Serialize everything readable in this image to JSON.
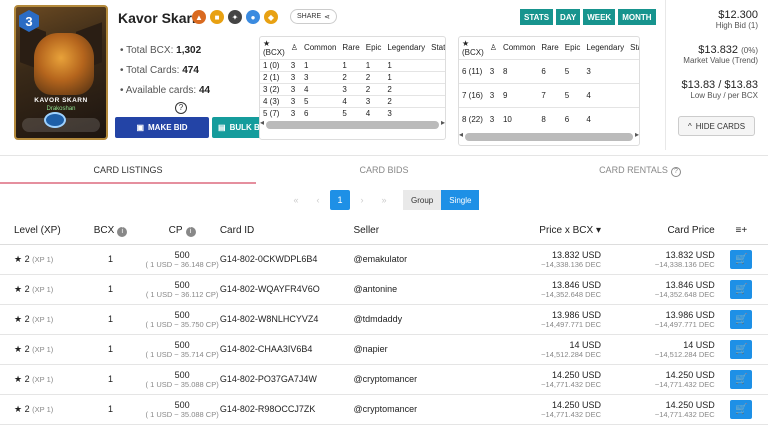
{
  "card": {
    "name": "Kavor Skarn",
    "mana": "3",
    "plate_name": "KAVOR SKARN",
    "plate_sub": "Drakoshan",
    "level_badge": "1"
  },
  "share_label": "SHARE",
  "stats": {
    "total_bcx_label": "Total BCX: ",
    "total_bcx": "1,302",
    "total_cards_label": "Total Cards: ",
    "total_cards": "474",
    "available_label": "Available cards: ",
    "available": "44"
  },
  "buttons": {
    "make_bid": "MAKE BID",
    "bulk_buy": "BULK BUY",
    "hide_cards": "HIDE CARDS"
  },
  "mini_table_headers": [
    "(BCX)",
    "Common",
    "Rare",
    "Epic",
    "Legendary",
    "Stats"
  ],
  "mini_table_1": [
    [
      "1 (0)",
      "3",
      "1",
      "1",
      "1",
      "1"
    ],
    [
      "2 (1)",
      "3",
      "3",
      "2",
      "2",
      "1"
    ],
    [
      "3 (2)",
      "3",
      "4",
      "3",
      "2",
      "2"
    ],
    [
      "4 (3)",
      "3",
      "5",
      "4",
      "3",
      "2"
    ],
    [
      "5 (7)",
      "3",
      "6",
      "5",
      "4",
      "3"
    ]
  ],
  "mini_table_2": [
    [
      "6 (11)",
      "3",
      "8",
      "6",
      "5",
      "3"
    ],
    [
      "7 (16)",
      "3",
      "9",
      "7",
      "5",
      "4"
    ],
    [
      "8 (22)",
      "3",
      "10",
      "8",
      "6",
      "4"
    ]
  ],
  "top_tabs": [
    "STATS",
    "DAY",
    "WEEK",
    "MONTH"
  ],
  "price_panel": {
    "high_bid": "$12.300",
    "high_bid_label": "High Bid (1)",
    "market_value": "$13.832",
    "market_change": "(0%)",
    "market_label": "Market Value (Trend)",
    "low_buy": "$13.83 / $13.83",
    "low_buy_label": "Low Buy / per BCX"
  },
  "section_tabs": [
    "CARD LISTINGS",
    "CARD BIDS",
    "CARD RENTALS"
  ],
  "pager": {
    "first": "«",
    "prev": "‹",
    "page": "1",
    "next": "›",
    "last": "»"
  },
  "toggle": {
    "group": "Group",
    "single": "Single"
  },
  "columns": [
    "Level (XP)",
    "BCX",
    "CP",
    "Card ID",
    "Seller",
    "Price x BCX",
    "Card Price"
  ],
  "rows": [
    {
      "level": "2",
      "xp": "(XP 1)",
      "bcx": "1",
      "cp": "500",
      "cp_sub": "( 1 USD ~ 36.148 CP)",
      "card_id": "G14-802-0CKWDPL6B4",
      "seller": "@emakulator",
      "price": "13.832 USD",
      "price_dec": "~14,338.136 DEC",
      "card_price": "13.832 USD",
      "card_price_dec": "~14,338.136 DEC"
    },
    {
      "level": "2",
      "xp": "(XP 1)",
      "bcx": "1",
      "cp": "500",
      "cp_sub": "( 1 USD ~ 36.112 CP)",
      "card_id": "G14-802-WQAYFR4V6O",
      "seller": "@antonine",
      "price": "13.846 USD",
      "price_dec": "~14,352.648 DEC",
      "card_price": "13.846 USD",
      "card_price_dec": "~14,352.648 DEC"
    },
    {
      "level": "2",
      "xp": "(XP 1)",
      "bcx": "1",
      "cp": "500",
      "cp_sub": "( 1 USD ~ 35.750 CP)",
      "card_id": "G14-802-W8NLHCYVZ4",
      "seller": "@tdmdaddy",
      "price": "13.986 USD",
      "price_dec": "~14,497.771 DEC",
      "card_price": "13.986 USD",
      "card_price_dec": "~14,497.771 DEC"
    },
    {
      "level": "2",
      "xp": "(XP 1)",
      "bcx": "1",
      "cp": "500",
      "cp_sub": "( 1 USD ~ 35.714 CP)",
      "card_id": "G14-802-CHAA3IV6B4",
      "seller": "@napier",
      "price": "14 USD",
      "price_dec": "~14,512.284 DEC",
      "card_price": "14 USD",
      "card_price_dec": "~14,512.284 DEC"
    },
    {
      "level": "2",
      "xp": "(XP 1)",
      "bcx": "1",
      "cp": "500",
      "cp_sub": "( 1 USD ~ 35.088 CP)",
      "card_id": "G14-802-PO37GA7J4W",
      "seller": "@cryptomancer",
      "price": "14.250 USD",
      "price_dec": "~14,771.432 DEC",
      "card_price": "14.250 USD",
      "card_price_dec": "~14,771.432 DEC"
    },
    {
      "level": "2",
      "xp": "(XP 1)",
      "bcx": "1",
      "cp": "500",
      "cp_sub": "( 1 USD ~ 35.088 CP)",
      "card_id": "G14-802-R98OCCJ7ZK",
      "seller": "@cryptomancer",
      "price": "14.250 USD",
      "price_dec": "~14,771.432 DEC",
      "card_price": "14.250 USD",
      "card_price_dec": "~14,771.432 DEC"
    }
  ],
  "colors": {
    "accent_blue": "#1e90e6",
    "teal": "#17948e",
    "navy": "#2344a6",
    "tab_underline": "#e58f9e"
  }
}
